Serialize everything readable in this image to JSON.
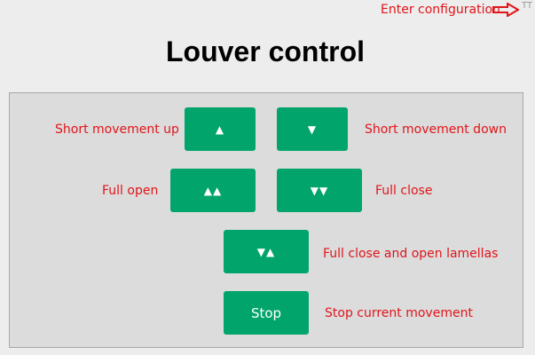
{
  "header": {
    "config_link": "Enter configuration",
    "corner_mark": "TT"
  },
  "page_title": "Louver control",
  "controls": {
    "short_up": {
      "glyph": "▲",
      "label": "Short movement up"
    },
    "short_down": {
      "glyph": "▼",
      "label": "Short movement down"
    },
    "full_open": {
      "glyph": "▲▲",
      "label": "Full open"
    },
    "full_close": {
      "glyph": "▼▼",
      "label": "Full close"
    },
    "close_open_lamellas": {
      "glyph": "▼▲",
      "label": "Full close and open lamellas"
    },
    "stop": {
      "glyph": "Stop",
      "label": "Stop current movement"
    }
  },
  "colors": {
    "accent": "#01a56b",
    "label_text": "#e0151a",
    "panel_bg": "#dcdcdc",
    "page_bg": "#ededed"
  },
  "icons": {
    "config_arrow": "arrow-right-outline-icon"
  }
}
